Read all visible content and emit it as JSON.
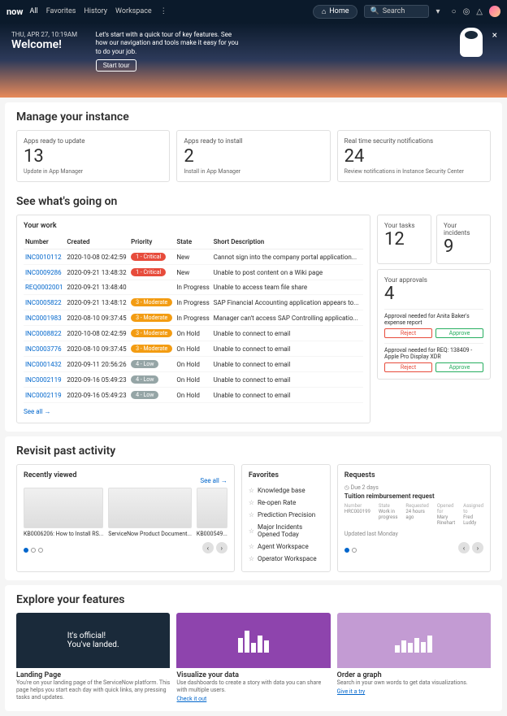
{
  "topbar": {
    "logo": "now",
    "nav": [
      "All",
      "Favorites",
      "History",
      "Workspace"
    ],
    "home": "Home",
    "search_placeholder": "Search"
  },
  "hero": {
    "date": "THU, APR 27, 10:19AM",
    "title": "Welcome!",
    "blurb": "Let's start with a quick tour of key features. See how our navigation and tools make it easy for you to do your job.",
    "cta": "Start tour"
  },
  "manage": {
    "heading": "Manage your instance",
    "cards": [
      {
        "label": "Apps ready to update",
        "num": "13",
        "sub": "Update in App Manager"
      },
      {
        "label": "Apps ready to install",
        "num": "2",
        "sub": "Install in App Manager"
      },
      {
        "label": "Real time security notifications",
        "num": "24",
        "sub": "Review notifications in Instance Security Center"
      }
    ]
  },
  "going": {
    "heading": "See what's going on",
    "work_title": "Your work",
    "cols": [
      "Number",
      "Created",
      "Priority",
      "State",
      "Short Description"
    ],
    "rows": [
      {
        "num": "INC0010112",
        "created": "2020-10-08 02:42:59",
        "pri": "1 - Critical",
        "pcls": "b-crit",
        "state": "New",
        "desc": "Cannot sign into the company portal application..."
      },
      {
        "num": "INC0009286",
        "created": "2020-09-21 13:48:32",
        "pri": "1 - Critical",
        "pcls": "b-crit",
        "state": "New",
        "desc": "Unable to post content on a Wiki page"
      },
      {
        "num": "REQ0002001",
        "created": "2020-09-21 13:48:40",
        "pri": "",
        "pcls": "",
        "state": "In Progress",
        "desc": "Unable to access team file share"
      },
      {
        "num": "INC0005822",
        "created": "2020-09-21 13:48:12",
        "pri": "3 - Moderate",
        "pcls": "b-mod",
        "state": "In Progress",
        "desc": "SAP Financial Accounting application appears to..."
      },
      {
        "num": "INC0001983",
        "created": "2020-08-10 09:37:45",
        "pri": "3 - Moderate",
        "pcls": "b-mod",
        "state": "In Progress",
        "desc": "Manager can't access SAP Controlling applicatio..."
      },
      {
        "num": "INC0008822",
        "created": "2020-10-08 02:42:59",
        "pri": "3 - Moderate",
        "pcls": "b-mod",
        "state": "On Hold",
        "desc": "Unable to connect to email"
      },
      {
        "num": "INC0003776",
        "created": "2020-08-10 09:37:45",
        "pri": "3 - Moderate",
        "pcls": "b-mod",
        "state": "On Hold",
        "desc": "Unable to connect to email"
      },
      {
        "num": "INC0001432",
        "created": "2020-09-11 20:56:26",
        "pri": "4 - Low",
        "pcls": "b-low",
        "state": "On Hold",
        "desc": "Unable to connect to email"
      },
      {
        "num": "INC0002119",
        "created": "2020-09-16 05:49:23",
        "pri": "4 - Low",
        "pcls": "b-low",
        "state": "On Hold",
        "desc": "Unable to connect to email"
      },
      {
        "num": "INC0002119",
        "created": "2020-09-16 05:49:23",
        "pri": "4 - Low",
        "pcls": "b-low",
        "state": "On Hold",
        "desc": "Unable to connect to email"
      }
    ],
    "see_all": "See all →",
    "tasks": {
      "label": "Your tasks",
      "num": "12"
    },
    "incidents": {
      "label": "Your incidents",
      "num": "9"
    },
    "approvals": {
      "label": "Your approvals",
      "num": "4",
      "items": [
        {
          "text": "Approval needed for Anita Baker's expense report",
          "reject": "Reject",
          "approve": "Approve"
        },
        {
          "text": "Approval needed for REQ: 138409 - Apple Pro Display XDR",
          "reject": "Reject",
          "approve": "Approve"
        }
      ]
    }
  },
  "revisit": {
    "heading": "Revisit past activity",
    "recent": {
      "title": "Recently viewed",
      "see_all": "See all →",
      "items": [
        "KB0006206: How to Install RS...",
        "ServiceNow Product Document...",
        "KB000549..."
      ]
    },
    "favorites": {
      "title": "Favorites",
      "items": [
        "Knowledge base",
        "Re-open Rate",
        "Prediction Precision",
        "Major Incidents Opened Today",
        "Agent Workspace",
        "Operator Workspace"
      ]
    },
    "requests": {
      "title": "Requests",
      "due": "Due 2 days",
      "name": "Tuition reimbursement request",
      "meta": [
        {
          "k": "Number",
          "v": "HRC000199"
        },
        {
          "k": "State",
          "v": "Work in progress"
        },
        {
          "k": "Requested",
          "v": "24 hours ago"
        },
        {
          "k": "Opened for",
          "v": "Mary Rinehart"
        },
        {
          "k": "Assigned to",
          "v": "Fred Luddy"
        }
      ],
      "updated": "Updated last Monday"
    }
  },
  "explore": {
    "heading": "Explore your features",
    "cards": [
      {
        "img_text": "It's official!\nYou've landed.",
        "title": "Landing Page",
        "desc": "You're on your landing page of the ServiceNow platform. This page helps you start each day with quick links, any pressing tasks and updates.",
        "link": ""
      },
      {
        "img_text": "",
        "title": "Visualize your data",
        "desc": "Use dashboards to create a story with data you can share with multiple users.",
        "link": "Check it out"
      },
      {
        "img_text": "",
        "title": "Order a graph",
        "desc": "Search in your own words to get data visualizations.",
        "link": "Give it a try"
      }
    ]
  }
}
